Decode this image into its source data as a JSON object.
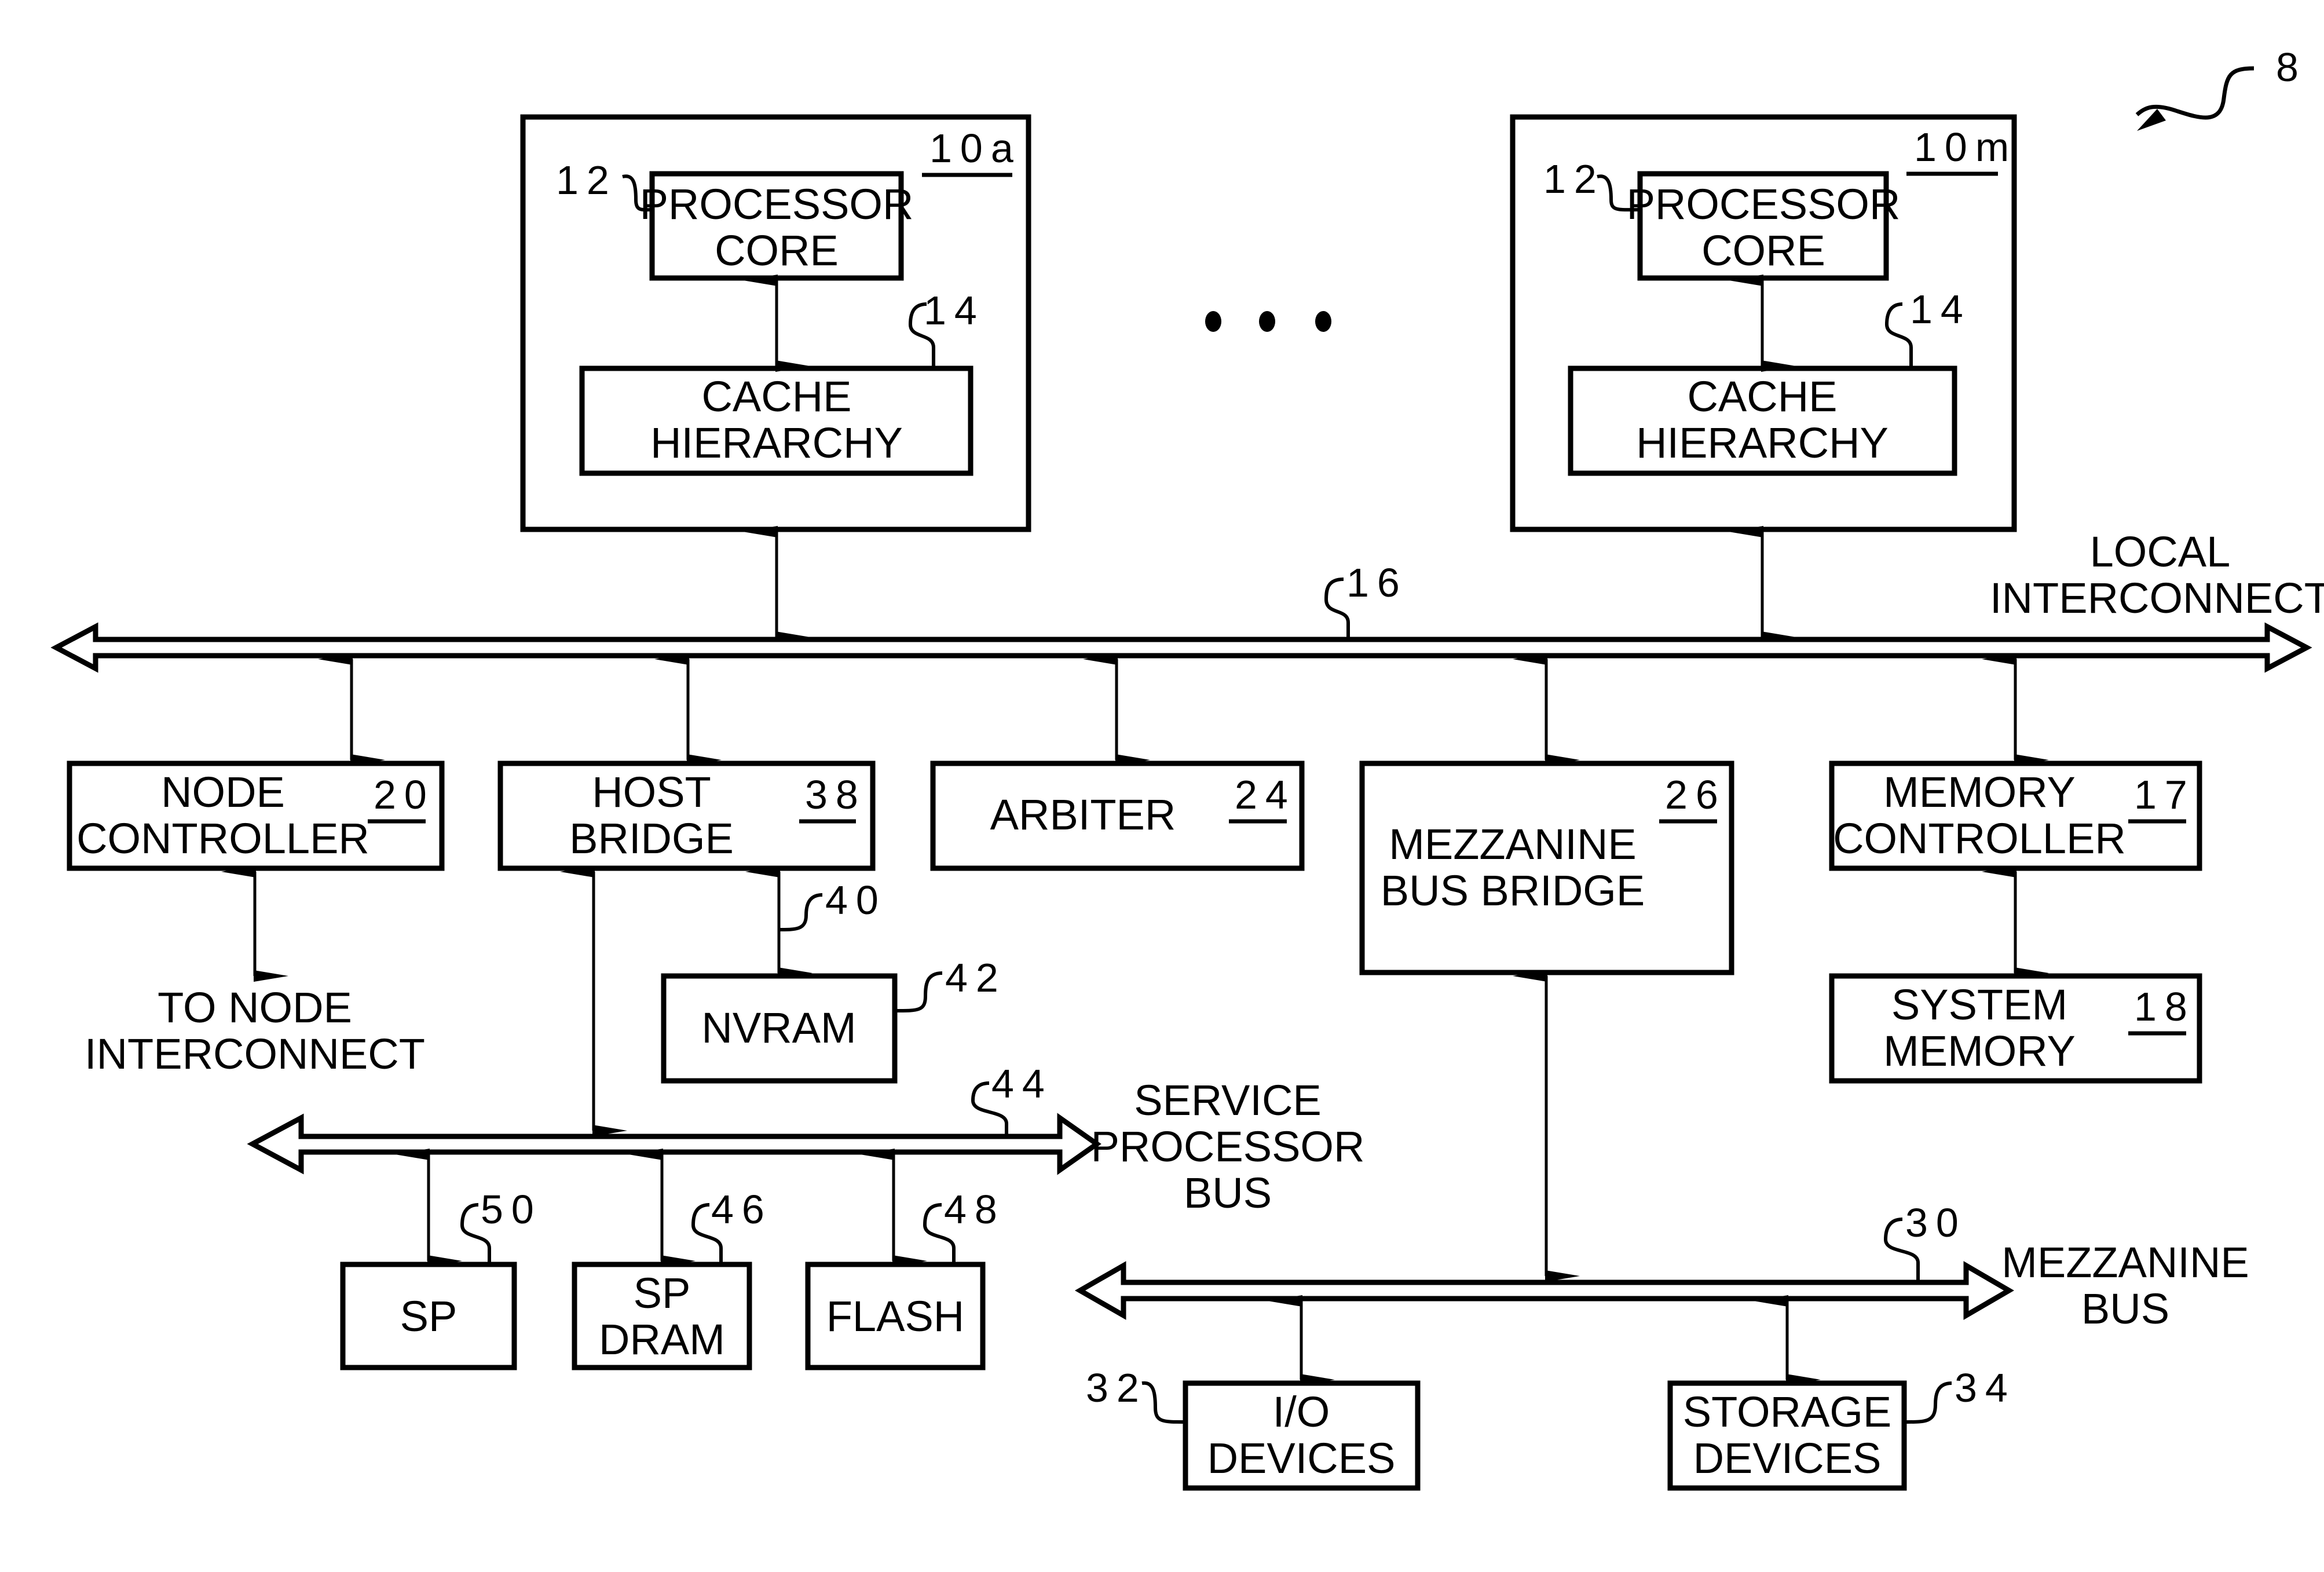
{
  "figure": {
    "ref": "8",
    "ellipsis": "• • •"
  },
  "processors": [
    {
      "ref": "10a",
      "core": {
        "lines": [
          "PROCESSOR",
          "CORE"
        ],
        "ref": "12"
      },
      "cache": {
        "lines": [
          "CACHE",
          "HIERARCHY"
        ],
        "ref": "14"
      }
    },
    {
      "ref": "10m",
      "core": {
        "lines": [
          "PROCESSOR",
          "CORE"
        ],
        "ref": "12"
      },
      "cache": {
        "lines": [
          "CACHE",
          "HIERARCHY"
        ],
        "ref": "14"
      }
    }
  ],
  "local_interconnect": {
    "lines": [
      "LOCAL",
      "INTERCONNECT"
    ],
    "ref": "16"
  },
  "node_controller": {
    "lines": [
      "NODE",
      "CONTROLLER"
    ],
    "ref": "20"
  },
  "node_interconnect": {
    "lines": [
      "TO NODE",
      "INTERCONNECT"
    ]
  },
  "host_bridge": {
    "lines": [
      "HOST",
      "BRIDGE"
    ],
    "ref": "38"
  },
  "host_nvram_link": {
    "ref": "40"
  },
  "nvram": {
    "label": "NVRAM",
    "ref": "42"
  },
  "arbiter": {
    "label": "ARBITER",
    "ref": "24"
  },
  "mezzanine_bridge": {
    "lines": [
      "MEZZANINE",
      "BUS BRIDGE"
    ],
    "ref": "26"
  },
  "memory_controller": {
    "lines": [
      "MEMORY",
      "CONTROLLER"
    ],
    "ref": "17"
  },
  "system_memory": {
    "lines": [
      "SYSTEM",
      "MEMORY"
    ],
    "ref": "18"
  },
  "service_bus": {
    "lines": [
      "SERVICE",
      "PROCESSOR",
      "BUS"
    ],
    "ref": "44"
  },
  "sp": {
    "label": "SP",
    "ref": "50"
  },
  "sp_dram": {
    "lines": [
      "SP",
      "DRAM"
    ],
    "ref": "46"
  },
  "flash": {
    "label": "FLASH",
    "ref": "48"
  },
  "mezzanine_bus": {
    "lines": [
      "MEZZANINE",
      "BUS"
    ],
    "ref": "30"
  },
  "io_devices": {
    "lines": [
      "I/O",
      "DEVICES"
    ],
    "ref": "32"
  },
  "storage_devices": {
    "lines": [
      "STORAGE",
      "DEVICES"
    ],
    "ref": "34"
  }
}
